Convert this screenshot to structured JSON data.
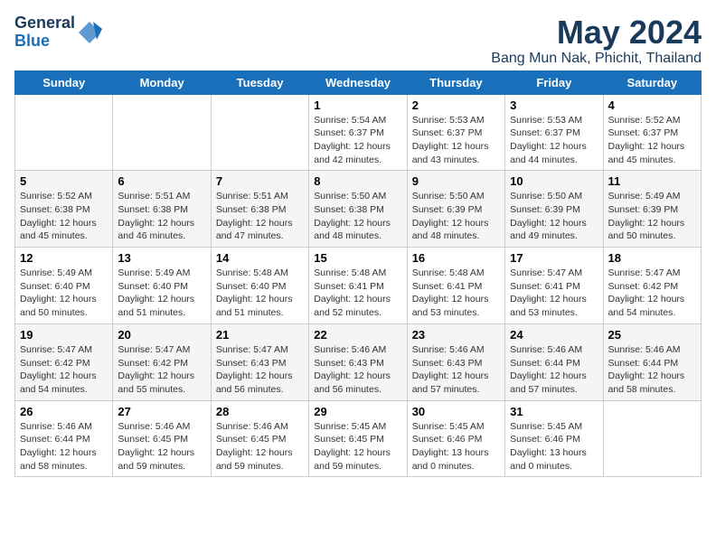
{
  "logo": {
    "general": "General",
    "blue": "Blue"
  },
  "title": "May 2024",
  "subtitle": "Bang Mun Nak, Phichit, Thailand",
  "days_of_week": [
    "Sunday",
    "Monday",
    "Tuesday",
    "Wednesday",
    "Thursday",
    "Friday",
    "Saturday"
  ],
  "weeks": [
    [
      {
        "day": "",
        "info": ""
      },
      {
        "day": "",
        "info": ""
      },
      {
        "day": "",
        "info": ""
      },
      {
        "day": "1",
        "info": "Sunrise: 5:54 AM\nSunset: 6:37 PM\nDaylight: 12 hours\nand 42 minutes."
      },
      {
        "day": "2",
        "info": "Sunrise: 5:53 AM\nSunset: 6:37 PM\nDaylight: 12 hours\nand 43 minutes."
      },
      {
        "day": "3",
        "info": "Sunrise: 5:53 AM\nSunset: 6:37 PM\nDaylight: 12 hours\nand 44 minutes."
      },
      {
        "day": "4",
        "info": "Sunrise: 5:52 AM\nSunset: 6:37 PM\nDaylight: 12 hours\nand 45 minutes."
      }
    ],
    [
      {
        "day": "5",
        "info": "Sunrise: 5:52 AM\nSunset: 6:38 PM\nDaylight: 12 hours\nand 45 minutes."
      },
      {
        "day": "6",
        "info": "Sunrise: 5:51 AM\nSunset: 6:38 PM\nDaylight: 12 hours\nand 46 minutes."
      },
      {
        "day": "7",
        "info": "Sunrise: 5:51 AM\nSunset: 6:38 PM\nDaylight: 12 hours\nand 47 minutes."
      },
      {
        "day": "8",
        "info": "Sunrise: 5:50 AM\nSunset: 6:38 PM\nDaylight: 12 hours\nand 48 minutes."
      },
      {
        "day": "9",
        "info": "Sunrise: 5:50 AM\nSunset: 6:39 PM\nDaylight: 12 hours\nand 48 minutes."
      },
      {
        "day": "10",
        "info": "Sunrise: 5:50 AM\nSunset: 6:39 PM\nDaylight: 12 hours\nand 49 minutes."
      },
      {
        "day": "11",
        "info": "Sunrise: 5:49 AM\nSunset: 6:39 PM\nDaylight: 12 hours\nand 50 minutes."
      }
    ],
    [
      {
        "day": "12",
        "info": "Sunrise: 5:49 AM\nSunset: 6:40 PM\nDaylight: 12 hours\nand 50 minutes."
      },
      {
        "day": "13",
        "info": "Sunrise: 5:49 AM\nSunset: 6:40 PM\nDaylight: 12 hours\nand 51 minutes."
      },
      {
        "day": "14",
        "info": "Sunrise: 5:48 AM\nSunset: 6:40 PM\nDaylight: 12 hours\nand 51 minutes."
      },
      {
        "day": "15",
        "info": "Sunrise: 5:48 AM\nSunset: 6:41 PM\nDaylight: 12 hours\nand 52 minutes."
      },
      {
        "day": "16",
        "info": "Sunrise: 5:48 AM\nSunset: 6:41 PM\nDaylight: 12 hours\nand 53 minutes."
      },
      {
        "day": "17",
        "info": "Sunrise: 5:47 AM\nSunset: 6:41 PM\nDaylight: 12 hours\nand 53 minutes."
      },
      {
        "day": "18",
        "info": "Sunrise: 5:47 AM\nSunset: 6:42 PM\nDaylight: 12 hours\nand 54 minutes."
      }
    ],
    [
      {
        "day": "19",
        "info": "Sunrise: 5:47 AM\nSunset: 6:42 PM\nDaylight: 12 hours\nand 54 minutes."
      },
      {
        "day": "20",
        "info": "Sunrise: 5:47 AM\nSunset: 6:42 PM\nDaylight: 12 hours\nand 55 minutes."
      },
      {
        "day": "21",
        "info": "Sunrise: 5:47 AM\nSunset: 6:43 PM\nDaylight: 12 hours\nand 56 minutes."
      },
      {
        "day": "22",
        "info": "Sunrise: 5:46 AM\nSunset: 6:43 PM\nDaylight: 12 hours\nand 56 minutes."
      },
      {
        "day": "23",
        "info": "Sunrise: 5:46 AM\nSunset: 6:43 PM\nDaylight: 12 hours\nand 57 minutes."
      },
      {
        "day": "24",
        "info": "Sunrise: 5:46 AM\nSunset: 6:44 PM\nDaylight: 12 hours\nand 57 minutes."
      },
      {
        "day": "25",
        "info": "Sunrise: 5:46 AM\nSunset: 6:44 PM\nDaylight: 12 hours\nand 58 minutes."
      }
    ],
    [
      {
        "day": "26",
        "info": "Sunrise: 5:46 AM\nSunset: 6:44 PM\nDaylight: 12 hours\nand 58 minutes."
      },
      {
        "day": "27",
        "info": "Sunrise: 5:46 AM\nSunset: 6:45 PM\nDaylight: 12 hours\nand 59 minutes."
      },
      {
        "day": "28",
        "info": "Sunrise: 5:46 AM\nSunset: 6:45 PM\nDaylight: 12 hours\nand 59 minutes."
      },
      {
        "day": "29",
        "info": "Sunrise: 5:45 AM\nSunset: 6:45 PM\nDaylight: 12 hours\nand 59 minutes."
      },
      {
        "day": "30",
        "info": "Sunrise: 5:45 AM\nSunset: 6:46 PM\nDaylight: 13 hours\nand 0 minutes."
      },
      {
        "day": "31",
        "info": "Sunrise: 5:45 AM\nSunset: 6:46 PM\nDaylight: 13 hours\nand 0 minutes."
      },
      {
        "day": "",
        "info": ""
      }
    ]
  ]
}
